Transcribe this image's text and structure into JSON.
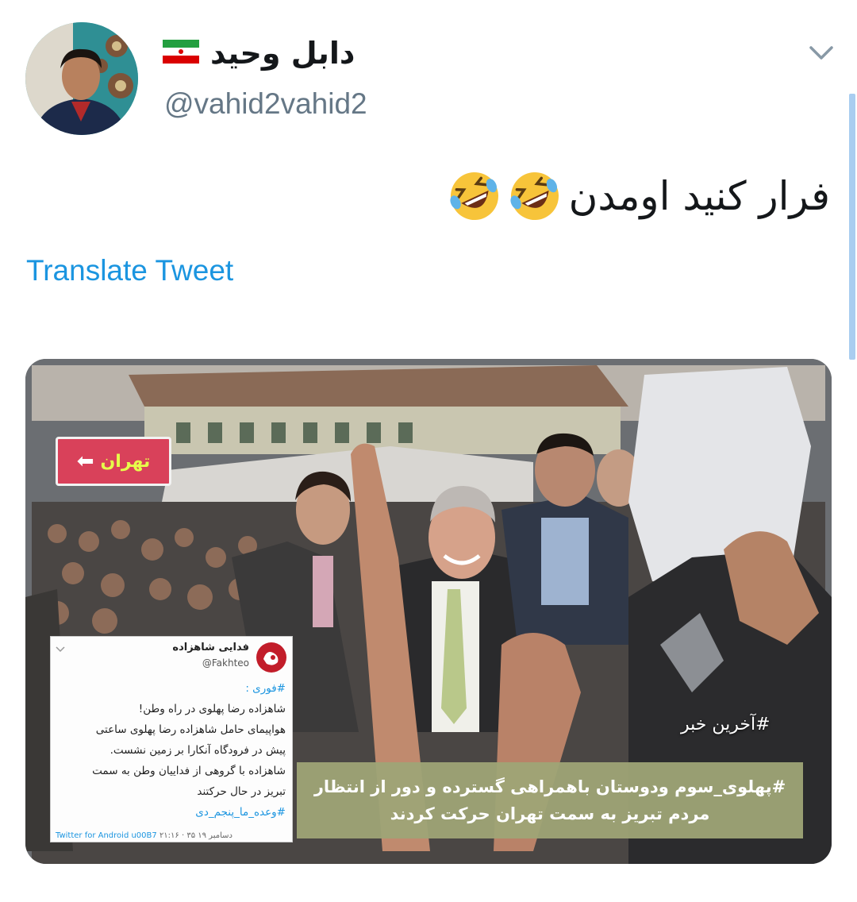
{
  "tweet": {
    "author_name": "دابل وحید",
    "flag": "🇮🇷",
    "handle": "@vahid2vahid2",
    "text": "فرار کنید اومدن",
    "emoji": [
      "🤣",
      "🤣"
    ],
    "translate_label": "Translate Tweet"
  },
  "media": {
    "street_sign": {
      "text": "تهران",
      "arrow": "⬅"
    },
    "embedded_tweet": {
      "name": "فدایی شاهزاده",
      "handle": "@Fakhteo",
      "hashtag_top": "#فوری :",
      "lines": [
        "شاهزاده رضا پهلوی در راه وطن!",
        "هواپیمای حامل شاهزاده رضا پهلوی ساعتی",
        "پیش در فرودگاه آنکارا بر زمین نشست.",
        "شاهزاده با گروهی از فداییان وطن به سمت",
        "تبریز در حال حرکتند"
      ],
      "hashtag_bottom": "#وعده_ما_پنجم_دی",
      "footer_time": "۲۱:۱۶ · ۳۵ دسامبر ۱۹",
      "footer_source": "Twitter for Android u00B7"
    },
    "news_hashtag": "#آخرین خبر",
    "caption_lines": [
      "#پهلوی_سوم ودوستان باهمراهی گسترده و دور از انتظار",
      "مردم تبریز به سمت تهران حرکت کردند"
    ]
  },
  "colors": {
    "link": "#1b95e0",
    "secondary_text": "#657786",
    "caption_bg": "#9ea476"
  }
}
